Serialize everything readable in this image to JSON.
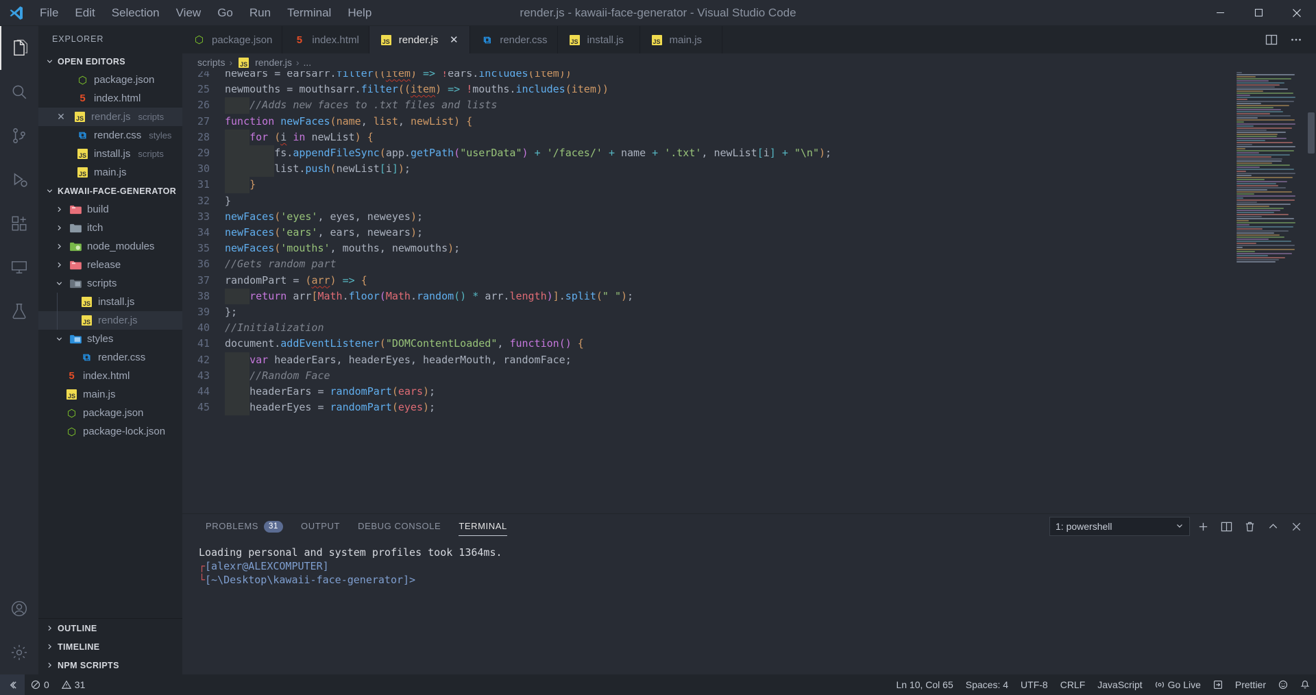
{
  "titlebar": {
    "logo_icon": "vscode-logo-icon",
    "title": "render.js - kawaii-face-generator - Visual Studio Code",
    "menus": [
      "File",
      "Edit",
      "Selection",
      "View",
      "Go",
      "Run",
      "Terminal",
      "Help"
    ],
    "window_controls": [
      {
        "name": "minimize-button",
        "glyph": "─"
      },
      {
        "name": "maximize-button",
        "glyph": "☐"
      },
      {
        "name": "close-button",
        "glyph": "✕"
      }
    ]
  },
  "activitybar": {
    "items": [
      {
        "name": "explorer-icon",
        "label": "Explorer",
        "active": true
      },
      {
        "name": "search-icon",
        "label": "Search",
        "active": false
      },
      {
        "name": "source-control-icon",
        "label": "Source Control",
        "active": false
      },
      {
        "name": "run-debug-icon",
        "label": "Run and Debug",
        "active": false
      },
      {
        "name": "extensions-icon",
        "label": "Extensions",
        "active": false
      },
      {
        "name": "remote-explorer-icon",
        "label": "Remote Explorer",
        "active": false
      },
      {
        "name": "test-beaker-icon",
        "label": "Testing",
        "active": false
      }
    ],
    "bottom": [
      {
        "name": "accounts-icon",
        "label": "Accounts"
      },
      {
        "name": "settings-gear-icon",
        "label": "Manage"
      }
    ]
  },
  "sidebar": {
    "title": "EXPLORER",
    "open_editors": {
      "label": "OPEN EDITORS",
      "expanded": true,
      "items": [
        {
          "name": "package.json",
          "icon": "node-icon",
          "meta": "",
          "active": false,
          "dim": false
        },
        {
          "name": "index.html",
          "icon": "html-icon",
          "meta": "",
          "active": false,
          "dim": false
        },
        {
          "name": "render.js",
          "icon": "js-icon",
          "meta": "scripts",
          "active": true,
          "dim": true
        },
        {
          "name": "render.css",
          "icon": "css-icon",
          "meta": "styles",
          "active": false,
          "dim": false
        },
        {
          "name": "install.js",
          "icon": "js-icon",
          "meta": "scripts",
          "active": false,
          "dim": false
        },
        {
          "name": "main.js",
          "icon": "js-icon",
          "meta": "",
          "active": false,
          "dim": false
        }
      ]
    },
    "project": {
      "label": "KAWAII-FACE-GENERATOR",
      "expanded": true,
      "items": [
        {
          "name": "build",
          "type": "folder",
          "icon": "folder-red-icon",
          "expanded": false,
          "depth": 1
        },
        {
          "name": "itch",
          "type": "folder",
          "icon": "folder-gray-icon",
          "expanded": false,
          "depth": 1
        },
        {
          "name": "node_modules",
          "type": "folder",
          "icon": "folder-green-icon",
          "expanded": false,
          "depth": 1
        },
        {
          "name": "release",
          "type": "folder",
          "icon": "folder-red-icon",
          "expanded": false,
          "depth": 1
        },
        {
          "name": "scripts",
          "type": "folder",
          "icon": "folder-scripts-icon",
          "expanded": true,
          "depth": 1
        },
        {
          "name": "install.js",
          "type": "file",
          "icon": "js-icon",
          "depth": 2
        },
        {
          "name": "render.js",
          "type": "file",
          "icon": "js-icon",
          "depth": 2,
          "active": true,
          "dim": true
        },
        {
          "name": "styles",
          "type": "folder",
          "icon": "folder-styles-icon",
          "expanded": true,
          "depth": 1
        },
        {
          "name": "render.css",
          "type": "file",
          "icon": "css-icon",
          "depth": 2
        },
        {
          "name": "index.html",
          "type": "file",
          "icon": "html-icon",
          "depth": 1
        },
        {
          "name": "main.js",
          "type": "file",
          "icon": "js-icon",
          "depth": 1
        },
        {
          "name": "package.json",
          "type": "file",
          "icon": "node-icon",
          "depth": 1
        },
        {
          "name": "package-lock.json",
          "type": "file",
          "icon": "node-icon",
          "depth": 1
        }
      ]
    },
    "footers": [
      {
        "label": "OUTLINE",
        "name": "outline-section"
      },
      {
        "label": "TIMELINE",
        "name": "timeline-section"
      },
      {
        "label": "NPM SCRIPTS",
        "name": "npm-scripts-section"
      }
    ]
  },
  "tabs": [
    {
      "label": "package.json",
      "icon": "node-icon",
      "active": false,
      "close": false
    },
    {
      "label": "index.html",
      "icon": "html-icon",
      "active": false,
      "close": false
    },
    {
      "label": "render.js",
      "icon": "js-icon",
      "active": true,
      "close": true
    },
    {
      "label": "render.css",
      "icon": "css-icon",
      "active": false,
      "close": false
    },
    {
      "label": "install.js",
      "icon": "js-icon",
      "active": false,
      "close": false
    },
    {
      "label": "main.js",
      "icon": "js-icon",
      "active": false,
      "close": false
    }
  ],
  "tabbar_actions": [
    {
      "name": "split-editor-icon",
      "glyph": "◫"
    },
    {
      "name": "more-actions-icon",
      "glyph": "⋯"
    }
  ],
  "breadcrumb": {
    "parts": [
      "scripts",
      "render.js",
      "..."
    ],
    "separator": "›",
    "file_icon": "js-icon"
  },
  "editor": {
    "first_line": 25,
    "lines": [
      {
        "n": 25,
        "text": "newmouths = mouthsarr.filter((item) => !mouths.includes(item))"
      },
      {
        "n": 26,
        "text": "    //Adds new faces to .txt files and lists"
      },
      {
        "n": 27,
        "text": "function newFaces(name, list, newList) {"
      },
      {
        "n": 28,
        "text": "    for (i in newList) {"
      },
      {
        "n": 29,
        "text": "        fs.appendFileSync(app.getPath(\"userData\") + '/faces/' + name + '.txt', newList[i] + \"\\n\");"
      },
      {
        "n": 30,
        "text": "        list.push(newList[i]);"
      },
      {
        "n": 31,
        "text": "    }"
      },
      {
        "n": 32,
        "text": "}"
      },
      {
        "n": 33,
        "text": "newFaces('eyes', eyes, neweyes);"
      },
      {
        "n": 34,
        "text": "newFaces('ears', ears, newears);"
      },
      {
        "n": 35,
        "text": "newFaces('mouths', mouths, newmouths);"
      },
      {
        "n": 36,
        "text": "//Gets random part"
      },
      {
        "n": 37,
        "text": "randomPart = (arr) => {"
      },
      {
        "n": 38,
        "text": "    return arr[Math.floor(Math.random() * arr.length)].split(\" \");"
      },
      {
        "n": 39,
        "text": "};"
      },
      {
        "n": 40,
        "text": "//Initialization"
      },
      {
        "n": 41,
        "text": "document.addEventListener(\"DOMContentLoaded\", function() {"
      },
      {
        "n": 42,
        "text": "    var headerEars, headerEyes, headerMouth, randomFace;"
      },
      {
        "n": 43,
        "text": "    //Random Face"
      },
      {
        "n": 44,
        "text": "    headerEars = randomPart(ears);"
      },
      {
        "n": 45,
        "text": "    headerEyes = randomPart(eyes);"
      }
    ],
    "language": "JavaScript"
  },
  "panel": {
    "tabs": [
      {
        "label": "PROBLEMS",
        "badge": "31",
        "active": false
      },
      {
        "label": "OUTPUT",
        "badge": "",
        "active": false
      },
      {
        "label": "DEBUG CONSOLE",
        "badge": "",
        "active": false
      },
      {
        "label": "TERMINAL",
        "badge": "",
        "active": true
      }
    ],
    "terminal_selector": {
      "value": "1: powershell",
      "chevron": "⌄"
    },
    "actions": [
      {
        "name": "new-terminal-icon",
        "glyph": "+"
      },
      {
        "name": "split-terminal-icon",
        "glyph": "◫"
      },
      {
        "name": "kill-terminal-icon",
        "glyph": "Ὕ1"
      },
      {
        "name": "maximize-panel-icon",
        "glyph": "⌃"
      },
      {
        "name": "close-panel-icon",
        "glyph": "✕"
      }
    ],
    "terminal_output": {
      "line1": "Loading personal and system profiles took 1364ms.",
      "prompt_user": "[alexr@ALEXCOMPUTER]",
      "prompt_path": "[~\\Desktop\\kawaii-face-generator]>"
    }
  },
  "statusbar": {
    "left": [
      {
        "name": "remote-indicator",
        "glyph": "≶",
        "label": ""
      },
      {
        "name": "errors-count",
        "glyph": "⊗",
        "label": "0"
      },
      {
        "name": "warnings-count",
        "glyph": "⚠",
        "label": "31"
      }
    ],
    "right": [
      {
        "name": "cursor-position",
        "label": "Ln 10, Col 65"
      },
      {
        "name": "indentation",
        "label": "Spaces: 4"
      },
      {
        "name": "encoding",
        "label": "UTF-8"
      },
      {
        "name": "eol",
        "label": "CRLF"
      },
      {
        "name": "language-mode",
        "label": "JavaScript"
      },
      {
        "name": "go-live",
        "label": "Go Live",
        "glyph": "◎"
      },
      {
        "name": "port-forward",
        "label": "",
        "glyph": "◳"
      },
      {
        "name": "prettier",
        "label": "Prettier"
      },
      {
        "name": "feedback",
        "label": "",
        "glyph": "☺"
      },
      {
        "name": "notifications-bell",
        "label": "",
        "glyph": "ὑ4"
      }
    ]
  },
  "colors": {
    "accent": "#61afef",
    "titlebar_bg": "#282c34",
    "sidebar_bg": "#21252b",
    "editor_bg": "#282c34",
    "js_yellow": "#f0db4f",
    "html_orange": "#e44d26",
    "css_blue": "#2496ed",
    "node_green": "#83cd29"
  }
}
